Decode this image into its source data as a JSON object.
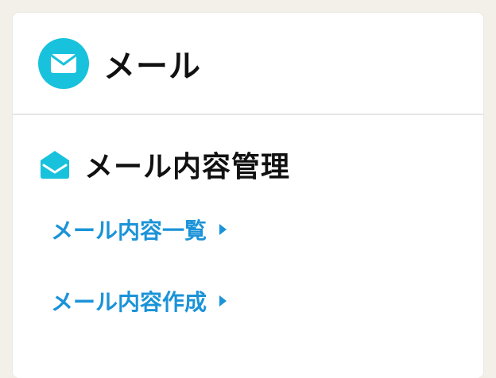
{
  "colors": {
    "page_background": "#f3f0ea",
    "card_background": "#ffffff",
    "accent": "#18c2dc",
    "link": "#1b93d8",
    "heading_text": "#111111"
  },
  "header": {
    "icon": "mail-icon",
    "title": "メール"
  },
  "section": {
    "icon": "open-envelope-icon",
    "title": "メール内容管理",
    "links": [
      {
        "label": "メール内容一覧",
        "icon": "caret-right-icon"
      },
      {
        "label": "メール内容作成",
        "icon": "caret-right-icon"
      }
    ]
  }
}
